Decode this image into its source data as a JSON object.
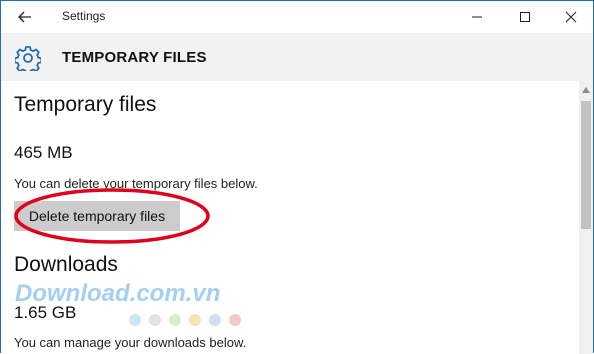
{
  "window": {
    "title": "Settings"
  },
  "header": {
    "title": "TEMPORARY FILES"
  },
  "temporary": {
    "heading": "Temporary files",
    "size": "465 MB",
    "description": "You can delete your temporary files below.",
    "button_label": "Delete temporary files"
  },
  "downloads": {
    "heading": "Downloads",
    "size": "1.65 GB",
    "description": "You can manage your downloads below."
  },
  "watermark": {
    "text": "Download.com.vn"
  },
  "colors": {
    "accent": "#1f6fb2",
    "highlight_ring": "#e0001a",
    "button_bg": "#cccccc"
  },
  "icons": [
    "back-arrow-icon",
    "minimize-icon",
    "maximize-icon",
    "close-icon",
    "gear-icon"
  ]
}
